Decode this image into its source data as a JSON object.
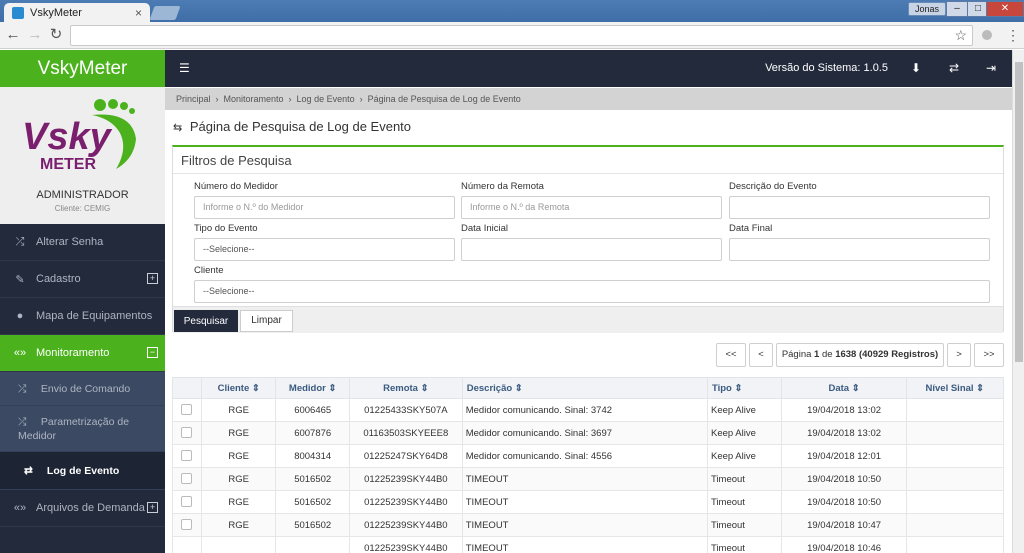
{
  "browser": {
    "tab_title": "VskyMeter",
    "tab_close": "×",
    "user": "Jonas",
    "win_min": "–",
    "win_max": "□",
    "win_close": "✕",
    "back": "←",
    "forward": "→",
    "reload": "↻",
    "star": "☆",
    "menu": "⋮"
  },
  "sidebar": {
    "brand": "VskyMeter",
    "role": "ADMINISTRADOR",
    "client": "Cliente: CEMIG",
    "logo": {
      "text_top": "Vsky",
      "text_bottom": "METER",
      "color_purple": "#7a1f6e",
      "color_green": "#4bb21e"
    },
    "items": [
      {
        "label": "Alterar Senha",
        "icon": "⤮"
      },
      {
        "label": "Cadastro",
        "icon": "✎",
        "toggle": "+"
      },
      {
        "label": "Mapa de Equipamentos",
        "icon": "●"
      },
      {
        "label": "Monitoramento",
        "icon": "«»",
        "toggle": "−"
      }
    ],
    "subitems": [
      {
        "label": "Envio de Comando",
        "icon": "⤮"
      },
      {
        "label_1": "Parametrização de",
        "label_2": "Medidor",
        "icon": "⤮"
      },
      {
        "label": "Log de Evento",
        "icon": "⇄"
      }
    ],
    "last_item": {
      "label": "Arquivos de Demanda",
      "icon": "«»",
      "toggle": "+"
    }
  },
  "header": {
    "menu_icon": "☰",
    "version": "Versão do Sistema: 1.0.5",
    "download_icon": "⬇",
    "switch_icon": "⇄",
    "logout_icon": "⇥"
  },
  "breadcrumb": [
    "Principal",
    "Monitoramento",
    "Log de Evento",
    "Página de Pesquisa de Log de Evento"
  ],
  "breadcrumb_sep": "›",
  "page": {
    "title_icon": "⇆",
    "title": "Página de Pesquisa de Log de Evento"
  },
  "filters": {
    "title": "Filtros de Pesquisa",
    "numero_medidor": {
      "label": "Número do Medidor",
      "placeholder": "Informe o N.º do Medidor"
    },
    "numero_remota": {
      "label": "Número da Remota",
      "placeholder": "Informe o N.º da Remota"
    },
    "descricao_evento": {
      "label": "Descrição do Evento",
      "value": ""
    },
    "tipo_evento": {
      "label": "Tipo do Evento",
      "value": "--Selecione--"
    },
    "data_inicial": {
      "label": "Data Inicial",
      "value": ""
    },
    "data_final": {
      "label": "Data Final",
      "value": ""
    },
    "cliente": {
      "label": "Cliente",
      "value": "--Selecione--"
    },
    "search_button": "Pesquisar",
    "clear_button": "Limpar"
  },
  "pagination": {
    "first": "<<",
    "prev": "<",
    "info_prefix": "Página ",
    "current": "1",
    "info_mid": " de ",
    "total": "1638 (40929 Registros)",
    "next": ">",
    "last": ">>"
  },
  "table": {
    "columns": [
      "Cliente ⇕",
      "Medidor ⇕",
      "Remota ⇕",
      "Descrição ⇕",
      "Tipo ⇕",
      "Data ⇕",
      "Nível Sinal ⇕"
    ],
    "rows": [
      {
        "cliente": "RGE",
        "medidor": "6006465",
        "remota": "01225433SKY507A",
        "descricao": "Medidor comunicando. Sinal: 3742",
        "tipo": "Keep Alive",
        "data": "19/04/2018 13:02",
        "nivel": ""
      },
      {
        "cliente": "RGE",
        "medidor": "6007876",
        "remota": "01163503SKYEEE8",
        "descricao": "Medidor comunicando. Sinal: 3697",
        "tipo": "Keep Alive",
        "data": "19/04/2018 13:02",
        "nivel": ""
      },
      {
        "cliente": "RGE",
        "medidor": "8004314",
        "remota": "01225247SKY64D8",
        "descricao": "Medidor comunicando. Sinal: 4556",
        "tipo": "Keep Alive",
        "data": "19/04/2018 12:01",
        "nivel": ""
      },
      {
        "cliente": "RGE",
        "medidor": "5016502",
        "remota": "01225239SKY44B0",
        "descricao": "TIMEOUT",
        "tipo": "Timeout",
        "data": "19/04/2018 10:50",
        "nivel": ""
      },
      {
        "cliente": "RGE",
        "medidor": "5016502",
        "remota": "01225239SKY44B0",
        "descricao": "TIMEOUT",
        "tipo": "Timeout",
        "data": "19/04/2018 10:50",
        "nivel": ""
      },
      {
        "cliente": "RGE",
        "medidor": "5016502",
        "remota": "01225239SKY44B0",
        "descricao": "TIMEOUT",
        "tipo": "Timeout",
        "data": "19/04/2018 10:47",
        "nivel": ""
      },
      {
        "cliente": "",
        "medidor": "",
        "remota": "01225239SKY44B0",
        "descricao": "TIMEOUT",
        "tipo": "Timeout",
        "data": "19/04/2018 10:46",
        "nivel": ""
      }
    ]
  },
  "colors": {
    "accent_green": "#4bb21e",
    "dark_navy": "#232a3b",
    "submenu_blue": "#3b4a62"
  }
}
